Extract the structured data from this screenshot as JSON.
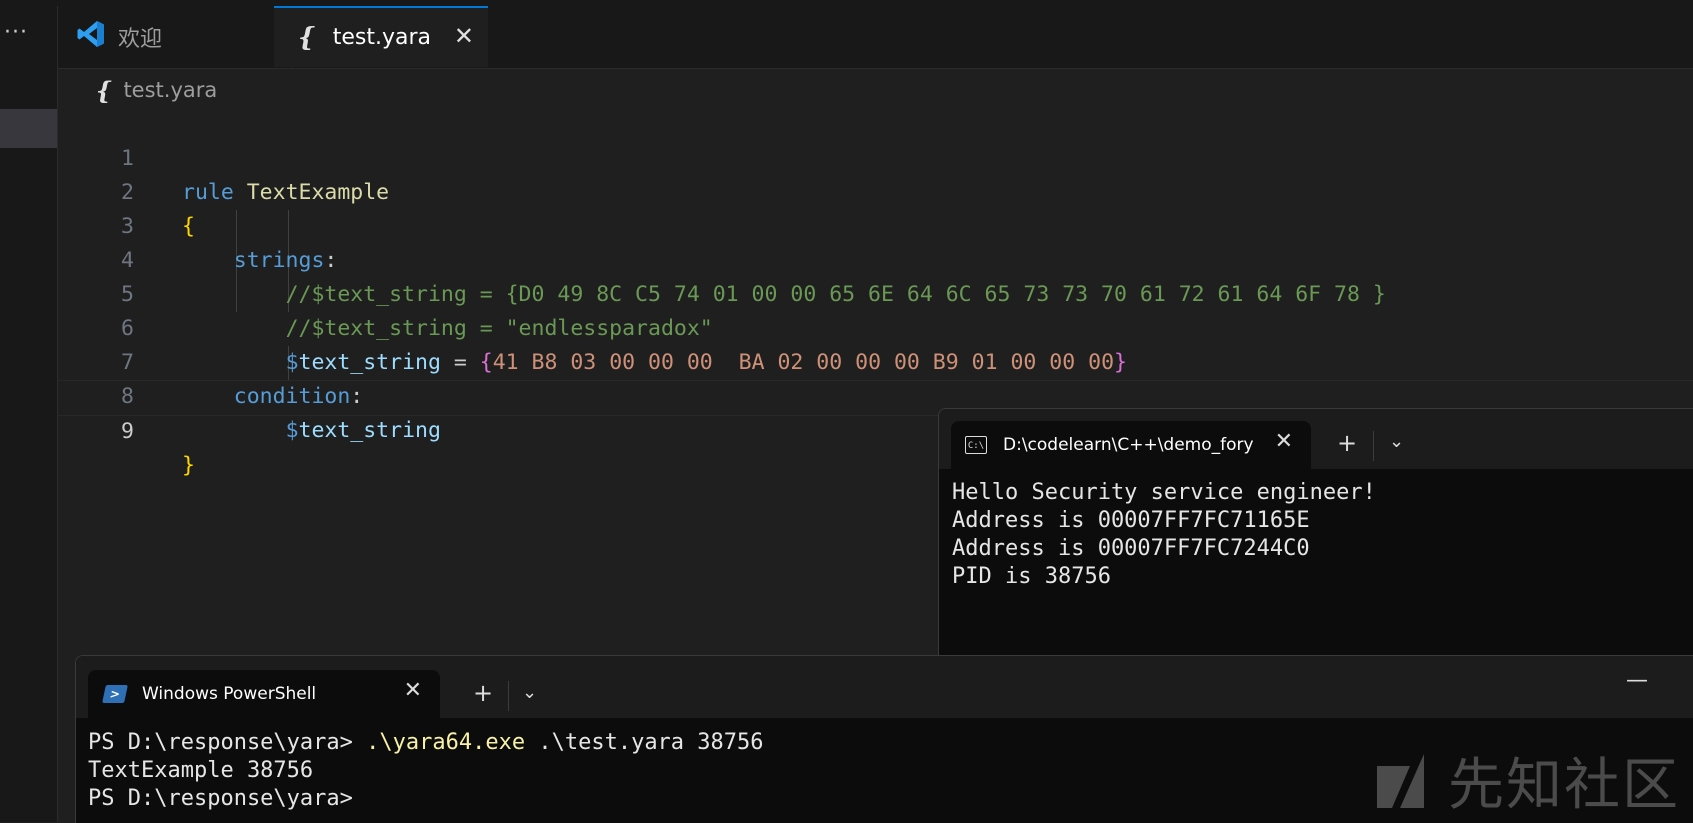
{
  "editor_tabs": [
    {
      "label": "欢迎",
      "icon": "vscode-icon"
    },
    {
      "label": "test.yara",
      "icon": "yara-brace-icon",
      "close_icon": "close-icon"
    }
  ],
  "breadcrumb": {
    "label": "test.yara"
  },
  "code": {
    "line_numbers": [
      "1",
      "2",
      "3",
      "4",
      "5",
      "6",
      "7",
      "8",
      "9"
    ],
    "l1_kw": "rule",
    "l1_name": "TextExample",
    "l2_brace": "{",
    "l3_kw": "strings",
    "l3_colon": ":",
    "l4": "//$text_string = {D0 49 8C C5 74 01 00 00 65 6E 64 6C 65 73 73 70 61 72 61 64 6F 78 }",
    "l5": "//$text_string = \"endlessparadox\"",
    "l6_dollar": "$",
    "l6_var": "text_string",
    "l6_eq": " = ",
    "l6_open": "{",
    "l6_hex": "41 B8 03 00 00 00  BA 02 00 00 00 B9 01 00 00 00",
    "l6_close": "}",
    "l7_kw": "condition",
    "l7_colon": ":",
    "l8_dollar": "$",
    "l8_var": "text_string",
    "l9_brace": "}"
  },
  "console_window": {
    "tab_title": "D:\\codelearn\\C++\\demo_fory",
    "icon_text": "C:\\",
    "lines": [
      "Hello Security service engineer!",
      "Address is 00007FF7FC71165E",
      "Address is 00007FF7FC7244C0",
      "PID is 38756"
    ]
  },
  "powershell_window": {
    "tab_title": "Windows PowerShell",
    "icon_text": ">",
    "prompt": "PS D:\\response\\yara> ",
    "command_exe": ".\\yara64.exe",
    "command_args": " .\\test.yara 38756",
    "output": "TextExample 38756",
    "prompt2": "PS D:\\response\\yara>"
  },
  "watermark": {
    "text": "先知社区"
  },
  "colors": {
    "accent": "#0078d4",
    "keyword": "#569cd6",
    "comment": "#6a9955",
    "hex": "#ce9178"
  }
}
